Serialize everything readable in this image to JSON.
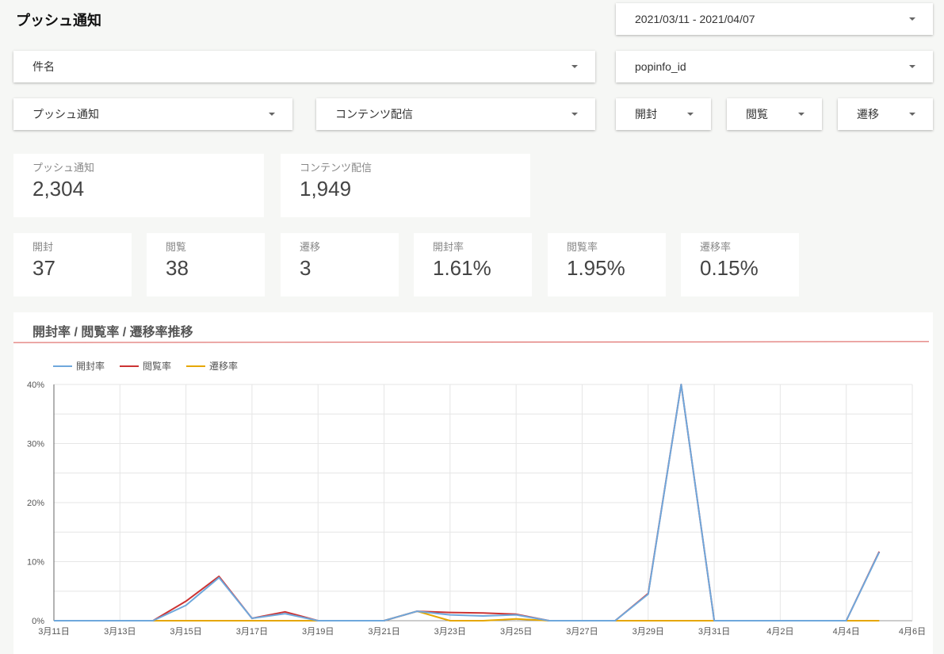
{
  "page": {
    "title": "プッシュ通知"
  },
  "filters": {
    "date_range": "2021/03/11 - 2021/04/07",
    "subject": "件名",
    "popinfo_id": "popinfo_id",
    "push": "プッシュ通知",
    "content": "コンテンツ配信",
    "open": "開封",
    "view": "閲覧",
    "transition": "遷移"
  },
  "scorecards": [
    {
      "label": "プッシュ通知",
      "value": "2,304"
    },
    {
      "label": "コンテンツ配信",
      "value": "1,949"
    },
    {
      "label": "開封",
      "value": "37"
    },
    {
      "label": "閲覧",
      "value": "38"
    },
    {
      "label": "遷移",
      "value": "3"
    },
    {
      "label": "開封率",
      "value": "1.61%"
    },
    {
      "label": "閲覧率",
      "value": "1.95%"
    },
    {
      "label": "遷移率",
      "value": "0.15%"
    }
  ],
  "chart_panel": {
    "title": "開封率 / 閲覧率 / 遷移率推移"
  },
  "colors": {
    "open": "#6fa8dc",
    "view": "#cc3333",
    "transition": "#e6a700",
    "accent_line": "#d9534f"
  },
  "icons": {
    "dropdown": "caret-down-icon"
  },
  "chart_data": {
    "type": "line",
    "title": "開封率 / 閲覧率 / 遷移率推移",
    "legend_position": "top-left",
    "grid": true,
    "x": [
      "3月11日",
      "3月12日",
      "3月13日",
      "3月14日",
      "3月15日",
      "3月16日",
      "3月17日",
      "3月18日",
      "3月19日",
      "3月20日",
      "3月21日",
      "3月22日",
      "3月23日",
      "3月24日",
      "3月25日",
      "3月26日",
      "3月27日",
      "3月28日",
      "3月29日",
      "3月30日",
      "3月31日",
      "4月1日",
      "4月2日",
      "4月3日",
      "4月4日",
      "4月5日",
      "4月6日"
    ],
    "x_tick_labels": [
      "3月11日",
      "3月13日",
      "3月15日",
      "3月17日",
      "3月19日",
      "3月21日",
      "3月23日",
      "3月25日",
      "3月27日",
      "3月29日",
      "3月31日",
      "4月2日",
      "4月4日",
      "4月6日"
    ],
    "y_ticks": [
      "0%",
      "10%",
      "20%",
      "30%",
      "40%"
    ],
    "ylim": [
      0,
      40
    ],
    "unit": "%",
    "series": [
      {
        "name": "開封率",
        "color": "#6fa8dc",
        "values": [
          0,
          0,
          0,
          0,
          2.6,
          7.3,
          0.4,
          1.2,
          0,
          0,
          0,
          1.6,
          1.0,
          0.8,
          1.0,
          0,
          0,
          0,
          4.5,
          40,
          0,
          0,
          0,
          0,
          0,
          11.6
        ]
      },
      {
        "name": "閲覧率",
        "color": "#cc3333",
        "values": [
          0,
          0,
          0,
          0,
          3.3,
          7.5,
          0.4,
          1.5,
          0,
          0,
          0,
          1.6,
          1.4,
          1.3,
          1.1,
          0,
          0,
          0,
          4.6,
          40,
          0,
          0,
          0,
          0,
          0,
          11.7
        ]
      },
      {
        "name": "遷移率",
        "color": "#e6a700",
        "values": [
          0,
          0,
          0,
          0,
          0,
          0,
          0,
          0,
          0,
          0,
          0,
          1.6,
          0,
          0,
          0.3,
          0,
          0,
          0,
          0,
          0,
          0,
          0,
          0,
          0,
          0,
          0
        ]
      }
    ]
  }
}
